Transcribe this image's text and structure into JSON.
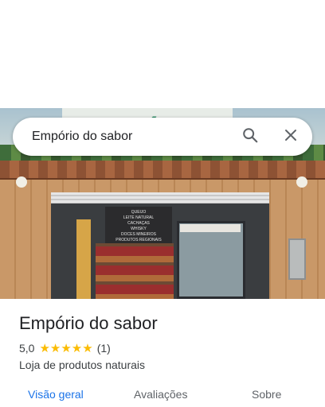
{
  "search": {
    "value": "Empório do sabor"
  },
  "icons": {
    "search": "search-icon",
    "close": "close-icon"
  },
  "photo": {
    "sign_text": "EMPÓRIO",
    "menu_board": [
      "QUEIJO",
      "LEITE NATURAL",
      "CACHAÇAS",
      "WHISKY",
      "DOCES MINEIROS",
      "PRODUTOS REGIONAIS"
    ]
  },
  "place": {
    "name": "Empório do sabor",
    "rating": "5,0",
    "stars": "★★★★★",
    "review_count": "(1)",
    "category": "Loja de produtos naturais"
  },
  "tabs": [
    {
      "label": "Visão geral",
      "active": true
    },
    {
      "label": "Avaliações",
      "active": false
    },
    {
      "label": "Sobre",
      "active": false
    }
  ],
  "colors": {
    "accent": "#1a73e8",
    "star": "#fbbc04",
    "text": "#202124"
  }
}
